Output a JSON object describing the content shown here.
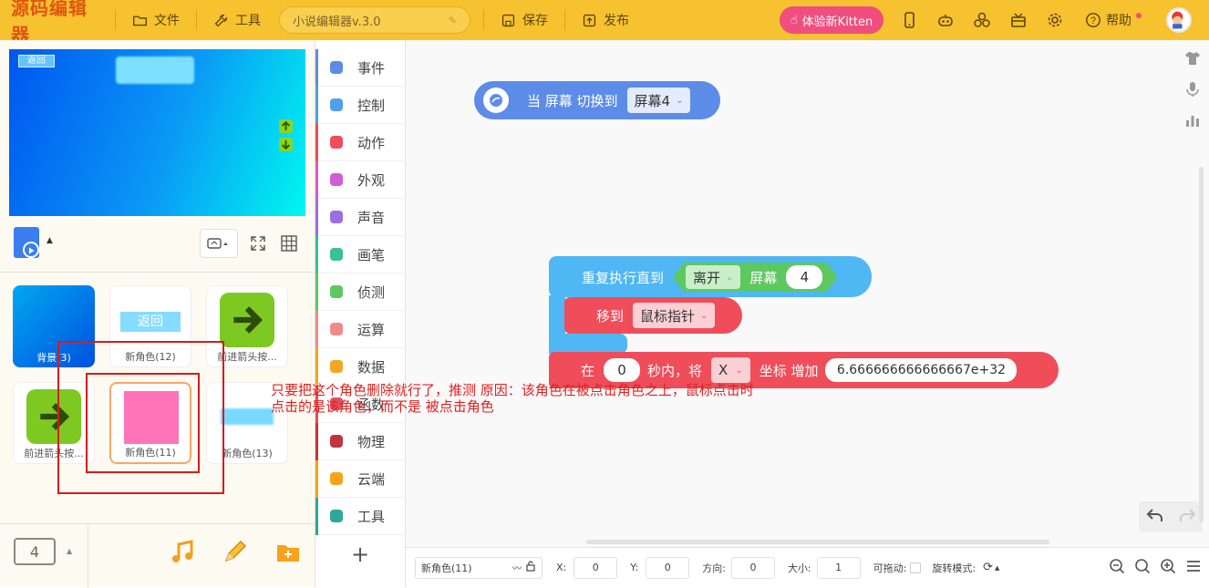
{
  "app": {
    "logo": "源码编辑器"
  },
  "toolbar": {
    "file": "文件",
    "tools": "工具",
    "project_title": "小说编辑器v.3.0",
    "save": "保存",
    "publish": "发布",
    "kitten": "体验新Kitten",
    "help": "帮助"
  },
  "stage": {
    "back_label": "返回"
  },
  "sprites": [
    {
      "label": "背景(3)",
      "kind": "background"
    },
    {
      "label": "新角色(12)",
      "kind": "return-button",
      "inner": "返回"
    },
    {
      "label": "前进箭头按...",
      "kind": "arrow"
    },
    {
      "label": "前进箭头按...",
      "kind": "arrow"
    },
    {
      "label": "新角色(11)",
      "kind": "pink",
      "selected": true
    },
    {
      "label": "新角色(13)",
      "kind": "blur"
    }
  ],
  "screen_counter": "4",
  "categories": [
    {
      "label": "事件",
      "color": "#5d8ce8"
    },
    {
      "label": "控制",
      "color": "#4f9ff1"
    },
    {
      "label": "动作",
      "color": "#ef4d5a"
    },
    {
      "label": "外观",
      "color": "#d35cd6"
    },
    {
      "label": "声音",
      "color": "#9a6fe4"
    },
    {
      "label": "画笔",
      "color": "#38c191"
    },
    {
      "label": "侦测",
      "color": "#5ec860"
    },
    {
      "label": "运算",
      "color": "#f08b8b"
    },
    {
      "label": "数据",
      "color": "#f5a623"
    },
    {
      "label": "函数",
      "color": "#e0505e"
    },
    {
      "label": "物理",
      "color": "#c2353f"
    },
    {
      "label": "云端",
      "color": "#f7a21a"
    },
    {
      "label": "工具",
      "color": "#2ba79c"
    }
  ],
  "blocks": {
    "event": {
      "text": "当 屏幕 切换到",
      "dropdown": "屏幕4"
    },
    "repeat": {
      "text": "重复执行直到",
      "cond_dropdown": "离开",
      "cond_text": "屏幕",
      "cond_value": "4"
    },
    "move": {
      "text": "移到",
      "dropdown": "鼠标指针"
    },
    "glide": {
      "prefix": "在",
      "seconds": "0",
      "mid": "秒内，将",
      "axis": "X",
      "suffix": "坐标 增加",
      "value": "6.666666666666667e+32"
    }
  },
  "annotation": {
    "line1": "只要把这个角色删除就行了，推测 原因：该角色在被点击角色之上，鼠标点击时",
    "line2": "点击的是该角色，而不是 被点击角色"
  },
  "properties": {
    "sprite_name": "新角色(11)",
    "x_label": "X:",
    "x_value": "0",
    "y_label": "Y:",
    "y_value": "0",
    "direction_label": "方向:",
    "direction_value": "0",
    "size_label": "大小:",
    "size_value": "1",
    "draggable_label": "可拖动:",
    "rotation_label": "旋转模式:"
  }
}
